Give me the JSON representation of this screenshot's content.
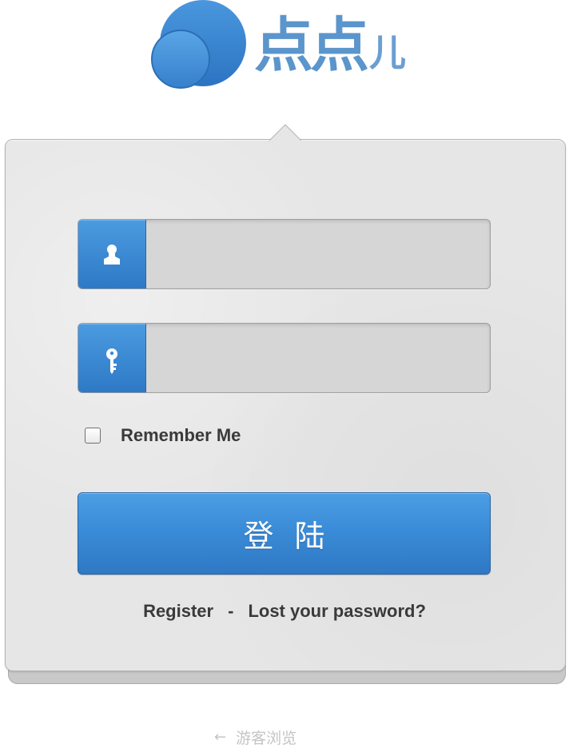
{
  "logo": {
    "text": "点点",
    "suffix": "儿"
  },
  "form": {
    "username_placeholder": "",
    "password_placeholder": "",
    "remember_label": "Remember Me",
    "login_label": "登陆"
  },
  "links": {
    "register": "Register",
    "separator": "-",
    "lost_password": "Lost your password?"
  },
  "guest": {
    "arrow": "←",
    "label": "游客浏览"
  },
  "colors": {
    "brand_blue": "#3a8cd8",
    "card_bg": "#e6e6e6",
    "text_dark": "#3a3a3a",
    "guest_gray": "#c4c4c4"
  },
  "icons": {
    "user": "user-icon",
    "key": "key-icon"
  }
}
